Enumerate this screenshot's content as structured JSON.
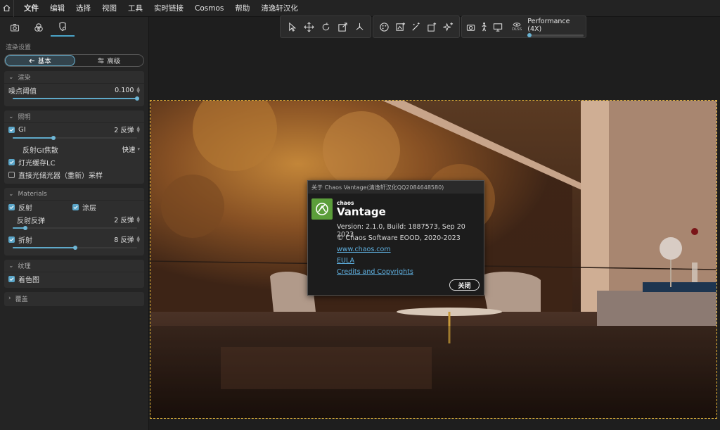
{
  "menubar": {
    "items": [
      "文件",
      "编辑",
      "选择",
      "视图",
      "工具",
      "实时链接",
      "Cosmos",
      "帮助",
      "清逸轩汉化"
    ]
  },
  "left_panel": {
    "section_label": "渲染设置",
    "mode_tabs": {
      "basic": "基本",
      "advanced": "高级"
    },
    "render_group": {
      "title": "渲染",
      "noise_label": "噪点阈值",
      "noise_value": "0.100",
      "noise_level": 1.0
    },
    "lighting_group": {
      "title": "照明",
      "gi_label": "GI",
      "gi_value": "2 反弹",
      "gi_level": 0.33,
      "reflect_gi_label": "反射GI焦散",
      "reflect_gi_value": "快速",
      "light_cache_label": "灯光缓存LC",
      "direct_sampling_label": "直接光储光器（重新）采样"
    },
    "materials_group": {
      "title": "Materials",
      "reflect_label": "反射",
      "coat_label": "涂层",
      "reflect_bounces_label": "反射反弹",
      "reflect_bounces_value": "2 反弹",
      "reflect_bounces_level": 0.1,
      "refract_label": "折射",
      "refract_value": "8 反弹",
      "refract_level": 0.5
    },
    "texture_group": {
      "title": "纹理",
      "shading_label": "着色图"
    },
    "overlay_group": {
      "title": "覆盖"
    }
  },
  "toolbar": {
    "performance_label": "Performance (4X)",
    "dlss_label": "DLSS"
  },
  "dialog": {
    "title": "关于 Chaos Vantage(清逸轩汉化QQ2084648580)",
    "brand_top": "chaos",
    "brand_name": "Vantage",
    "version": "Version: 2.1.0, Build: 1887573, Sep 20 2023",
    "copyright": "© Chaos Software EOOD, 2020-2023",
    "website": "www.chaos.com",
    "eula": "EULA",
    "credits": "Credits and Copyrights",
    "close_label": "关闭"
  },
  "colors": {
    "accent": "#5aa5c8",
    "selection_border": "#e5b53a",
    "brand_green": "#5b9e3a",
    "link": "#5fb0e0"
  }
}
